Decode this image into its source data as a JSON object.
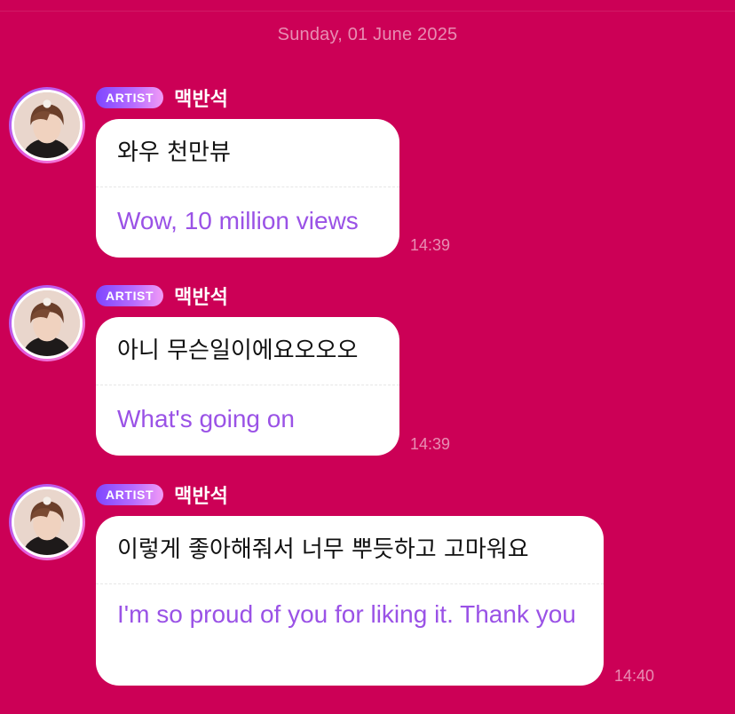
{
  "date_separator": "Sunday, 01 June 2025",
  "colors": {
    "background": "#cc0056",
    "bubble": "#ffffff",
    "translation_text": "#9a52e6",
    "badge_gradient": [
      "#7e46ff",
      "#f19bf6"
    ]
  },
  "messages": [
    {
      "badge": "ARTIST",
      "sender": "맥반석",
      "original": "와우 천만뷰",
      "translation": "Wow, 10 million views",
      "time": "14:39",
      "avatar_icon": "artist-profile-photo"
    },
    {
      "badge": "ARTIST",
      "sender": "맥반석",
      "original": "아니 무슨일이에요오오오",
      "translation": "What's going on",
      "time": "14:39",
      "avatar_icon": "artist-profile-photo"
    },
    {
      "badge": "ARTIST",
      "sender": "맥반석",
      "original": "이렇게 좋아해줘서 너무 뿌듯하고 고마워요",
      "translation": "I'm so proud of you for liking it. Thank you",
      "time": "14:40",
      "avatar_icon": "artist-profile-photo"
    }
  ]
}
